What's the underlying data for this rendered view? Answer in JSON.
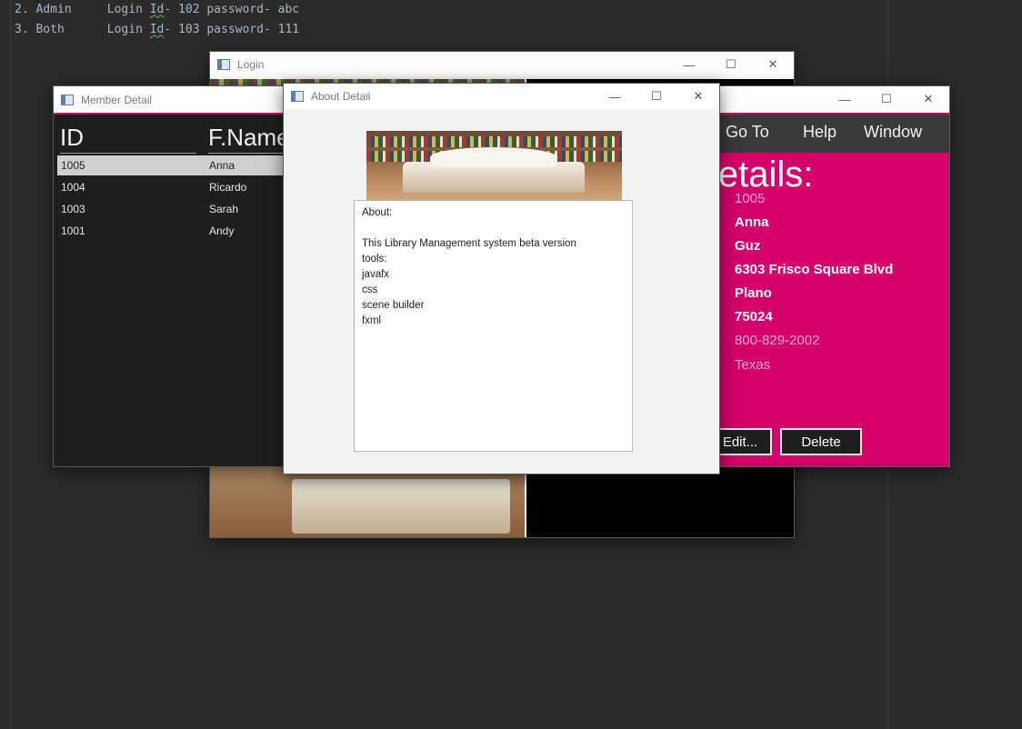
{
  "ide": {
    "lines": [
      {
        "num": "2.",
        "role": "Admin",
        "pre": "Login ",
        "id": "Id",
        "post": "- 102 password- abc"
      },
      {
        "num": "3.",
        "role": "Both",
        "pre": "Login ",
        "id": "Id",
        "post": "- 103 password- 111"
      }
    ]
  },
  "login_window": {
    "title": "Login"
  },
  "member_window": {
    "title": "Member Detail",
    "columns": [
      "ID",
      "F.Name"
    ],
    "rows": [
      {
        "id": "1005",
        "name": "Anna",
        "selected": true
      },
      {
        "id": "1004",
        "name": "Ricardo",
        "selected": false
      },
      {
        "id": "1003",
        "name": "Sarah",
        "selected": false
      },
      {
        "id": "1001",
        "name": "Andy",
        "selected": false
      }
    ],
    "menu": [
      "Go To",
      "Help",
      "Window"
    ],
    "detail_title": "Details:",
    "detail_values": [
      "1005",
      "Anna",
      "Guz",
      "6303 Frisco Square Blvd",
      "Plano",
      "75024",
      "800-829-2002",
      "Texas"
    ],
    "buttons": {
      "edit": "Edit...",
      "delete": "Delete"
    },
    "accent": "#d4006b"
  },
  "about_window": {
    "title": "About Detail",
    "text": "About:\n\nThis Library Management system beta version\ntools:\njavafx\ncss\nscene builder\nfxml"
  },
  "window_controls": {
    "minimize": "—",
    "maximize": "☐",
    "close": "✕"
  }
}
